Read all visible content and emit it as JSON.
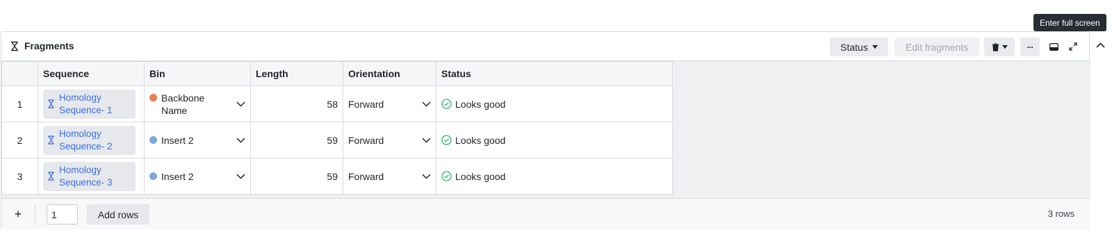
{
  "panel": {
    "title": "Fragments",
    "title_icon": "hourglass-icon"
  },
  "toolbar": {
    "status_label": "Status",
    "edit_fragments_label": "Edit fragments",
    "delete_icon": "trash-icon",
    "more_label": "···",
    "panel_toggle_icon": "panel-bottom-icon",
    "fullscreen_icon": "expand-icon",
    "collapse_icon": "chevron-up-icon"
  },
  "tooltip": {
    "text": "Enter full screen"
  },
  "table": {
    "columns": [
      "",
      "Sequence",
      "Bin",
      "Length",
      "Orientation",
      "Status"
    ],
    "rows": [
      {
        "index": "1",
        "sequence_line1": "Homology",
        "sequence_line2": "Sequence- 1",
        "bin": "Backbone Name",
        "bin_color": "#f07c4e",
        "length": "58",
        "orientation": "Forward",
        "status": "Looks good"
      },
      {
        "index": "2",
        "sequence_line1": "Homology",
        "sequence_line2": "Sequence- 2",
        "bin": "Insert 2",
        "bin_color": "#7fa7dc",
        "length": "59",
        "orientation": "Forward",
        "status": "Looks good"
      },
      {
        "index": "3",
        "sequence_line1": "Homology",
        "sequence_line2": "Sequence- 3",
        "bin": "Insert 2",
        "bin_color": "#7fa7dc",
        "length": "59",
        "orientation": "Forward",
        "status": "Looks good"
      }
    ]
  },
  "footer": {
    "plus_label": "+",
    "rows_input_value": "1",
    "add_rows_label": "Add rows",
    "row_count": "3 rows"
  },
  "colors": {
    "link": "#3b6fe0",
    "status_ok": "#2fb36b"
  }
}
